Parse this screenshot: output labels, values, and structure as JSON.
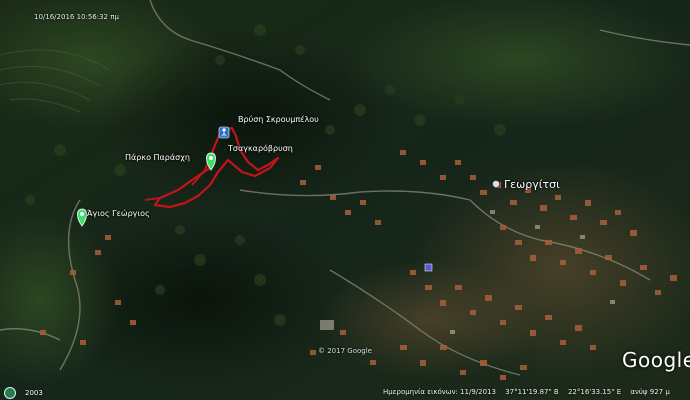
{
  "timestamp": "10/16/2016  10:56:32 πμ",
  "places": {
    "vrysi": "Βρύση Σκρουμπέλου",
    "tsagkarovrysi": "Τσαγκαρόβρυση",
    "parko": "Πάρκο Παράσχη",
    "agios": "Άγιος Γεώργιος",
    "town": "Γεωργίτσι"
  },
  "copyright": "© 2017 Google",
  "brand": "Google",
  "status": {
    "imagery_date": "Ημερομηνία εικόνων: 11/9/2013",
    "latitude": "37°11'19.87\" Β",
    "longitude": "22°16'33.15\" Ε",
    "elevation": "ανύψ  927 μ"
  },
  "historical_year": "2003",
  "colors": {
    "track": "#c4141b",
    "pin": "#3fe06a",
    "town_marker": "#e0e0e0"
  },
  "icons": [
    "pin-icon",
    "hiker-icon",
    "historical-imagery-icon"
  ]
}
